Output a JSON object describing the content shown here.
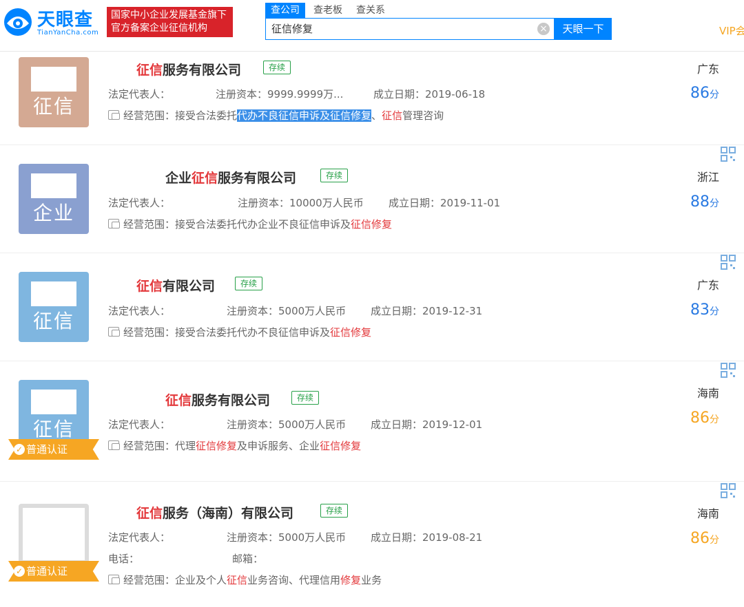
{
  "header": {
    "logo_text": "天眼查",
    "logo_sub": "TianYanCha.com",
    "badge_line1": "国家中小企业发展基金旗下",
    "badge_line2": "官方备案企业征信机构",
    "tabs": [
      "查公司",
      "查老板",
      "查关系"
    ],
    "search_value": "征信修复",
    "search_button": "天眼一下",
    "vip": "VIP会"
  },
  "labels": {
    "legal_rep": "法定代表人：",
    "phone": "电话：",
    "email": "邮箱：",
    "scope": "经营范围：",
    "score_unit": "分",
    "cert": "普通认证"
  },
  "results": [
    {
      "name_pre": "",
      "name_hl": "征信",
      "name_post": "服务有限公司",
      "status": "存续",
      "thumb_label": "征信",
      "thumb_color": "#d4a993",
      "capital": "注册资本：9999.9999万...",
      "founded": "成立日期：2019-06-18",
      "scope_a": "接受合法委托",
      "scope_sel": "代办不良征信申诉及征信修复",
      "scope_b": "、",
      "scope_hl": "征信",
      "scope_c": "管理咨询",
      "region": "广东",
      "score": "86",
      "score_color": "blue"
    },
    {
      "name_pre": "企业",
      "name_hl": "征信",
      "name_post": "服务有限公司",
      "status": "存续",
      "thumb_label": "企业",
      "thumb_color": "#8aa0d0",
      "capital": "注册资本：10000万人民币",
      "founded": "成立日期：2019-11-01",
      "scope_a": "接受合法委托代办企业不良征信申诉及",
      "scope_hl": "征信修复",
      "region": "浙江",
      "score": "88",
      "score_color": "blue"
    },
    {
      "name_pre": "",
      "name_hl": "征信",
      "name_post": "有限公司",
      "status": "存续",
      "thumb_label": "征信",
      "thumb_color": "#7fb6e0",
      "capital": "注册资本：5000万人民币",
      "founded": "成立日期：2019-12-31",
      "scope_a": "接受合法委托代办不良征信申诉及",
      "scope_hl": "征信修复",
      "region": "广东",
      "score": "83",
      "score_color": "blue"
    },
    {
      "name_pre": "",
      "name_hl": "征信",
      "name_post": "服务有限公司",
      "status": "存续",
      "thumb_label": "征信",
      "thumb_color": "#7fb6e0",
      "capital": "注册资本：5000万人民币",
      "founded": "成立日期：2019-12-01",
      "scope_a": "代理",
      "scope_hl": "征信修复",
      "scope_b": "及申诉服务、企业",
      "scope_hl2": "征信修复",
      "region": "海南",
      "score": "86",
      "score_color": "orange"
    },
    {
      "name_pre": "",
      "name_hl": "征信",
      "name_post": "服务（海南）有限公司",
      "status": "存续",
      "thumb_label": "",
      "thumb_color": "#dcdcdc",
      "capital": "注册资本：5000万人民币",
      "founded": "成立日期：2019-08-21",
      "scope_a": "企业及个人",
      "scope_hl": "征信",
      "scope_b": "业务咨询、代理信用",
      "scope_hl2": "修复",
      "scope_c": "业务",
      "region": "海南",
      "score": "86",
      "score_color": "orange"
    }
  ],
  "colors": {
    "brand_blue": "#0084ff",
    "highlight_red": "#e3383b",
    "status_green": "#27a048",
    "cert_orange": "#f6a623"
  },
  "icons": [
    "logo-mark-icon",
    "clear-icon",
    "scope-icon",
    "qr-code-icon",
    "verified-check-icon"
  ]
}
